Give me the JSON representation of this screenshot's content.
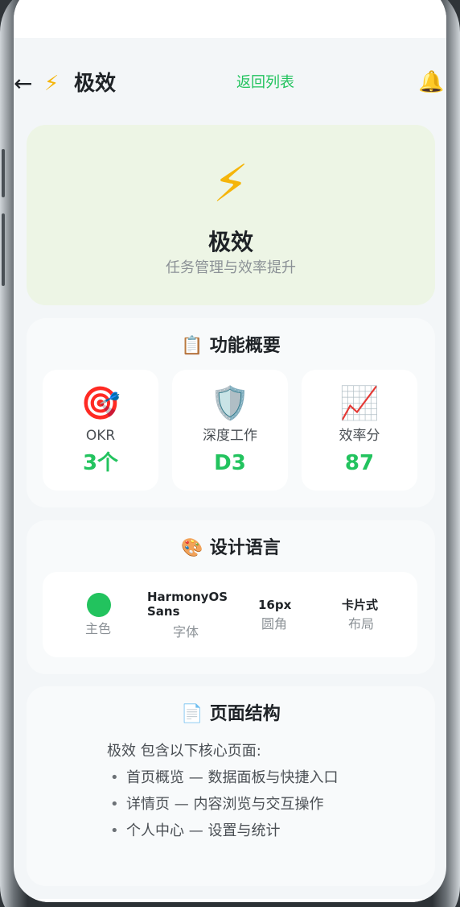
{
  "header": {
    "back_icon": "arrow-left-icon",
    "app_icon": "⚡",
    "app_name": "极效",
    "back_to_list": "返回列表",
    "bell_icon": "🔔"
  },
  "hero": {
    "icon": "⚡",
    "title": "极效",
    "subtitle": "任务管理与效率提升"
  },
  "features": {
    "icon": "📋",
    "title": "功能概要",
    "stats": [
      {
        "icon": "🎯",
        "label": "OKR",
        "value": "3个"
      },
      {
        "icon": "🛡️",
        "label": "深度工作",
        "value": "D3"
      },
      {
        "icon": "📈",
        "label": "效率分",
        "value": "87"
      }
    ]
  },
  "design": {
    "icon": "🎨",
    "title": "设计语言",
    "primary_color": "#22c35e",
    "primary_caption": "主色",
    "font_value": "HarmonyOS Sans",
    "font_caption": "字体",
    "radius_value": "16px",
    "radius_caption": "圆角",
    "layout_value": "卡片式",
    "layout_caption": "布局"
  },
  "pages": {
    "icon": "📄",
    "title": "页面结构",
    "intro": "极效 包含以下核心页面:",
    "items": [
      "首页概览 — 数据面板与快捷入口",
      "详情页 — 内容浏览与交互操作",
      "个人中心 — 设置与统计"
    ]
  },
  "colors": {
    "accent": "#22c35e",
    "hero_bg": "#edf5e5",
    "page_bg": "#f3f6f8"
  }
}
